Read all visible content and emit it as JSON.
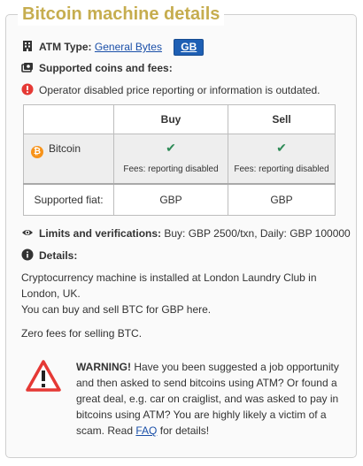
{
  "title": "Bitcoin machine details",
  "atm": {
    "label": "ATM Type:",
    "manufacturer": "General Bytes",
    "country_button": "GB"
  },
  "coins_heading": "Supported coins and fees:",
  "alert": "Operator disabled price reporting or information is outdated.",
  "table": {
    "headers": [
      "",
      "Buy",
      "Sell"
    ],
    "coin": {
      "name": "Bitcoin",
      "buy_check": "✔",
      "sell_check": "✔",
      "buy_fees": "Fees: reporting disabled",
      "sell_fees": "Fees: reporting disabled"
    },
    "fiat": {
      "label": "Supported fiat:",
      "buy": "GBP",
      "sell": "GBP"
    }
  },
  "limits": {
    "label": "Limits and verifications:",
    "value": "Buy: GBP 2500/txn, Daily: GBP 100000"
  },
  "details": {
    "label": "Details:",
    "line1": "Cryptocurrency machine is installed at London Laundry Club in London, UK.",
    "line2": "You can buy and sell BTC for GBP here.",
    "line3": "Zero fees for selling BTC."
  },
  "warning": {
    "bold": "WARNING!",
    "text": "Have you been suggested a job opportunity and then asked to send bitcoins using ATM? Or found a great deal, e.g. car on craiglist, and was asked to pay in bitcoins using ATM? You are highly likely a victim of a scam. Read",
    "link": "FAQ",
    "tail": "for details!"
  },
  "colors": {
    "title": "#c6ad4f",
    "link": "#1a4fa8",
    "button": "#1e5fb4",
    "check": "#2e8b57",
    "alert": "#e53935",
    "bitcoin": "#f7931a"
  },
  "icons": [
    "building-icon",
    "cash-icon",
    "alert-circle-icon",
    "bitcoin-icon",
    "check-icon",
    "eye-icon",
    "info-icon",
    "warning-triangle-icon"
  ]
}
